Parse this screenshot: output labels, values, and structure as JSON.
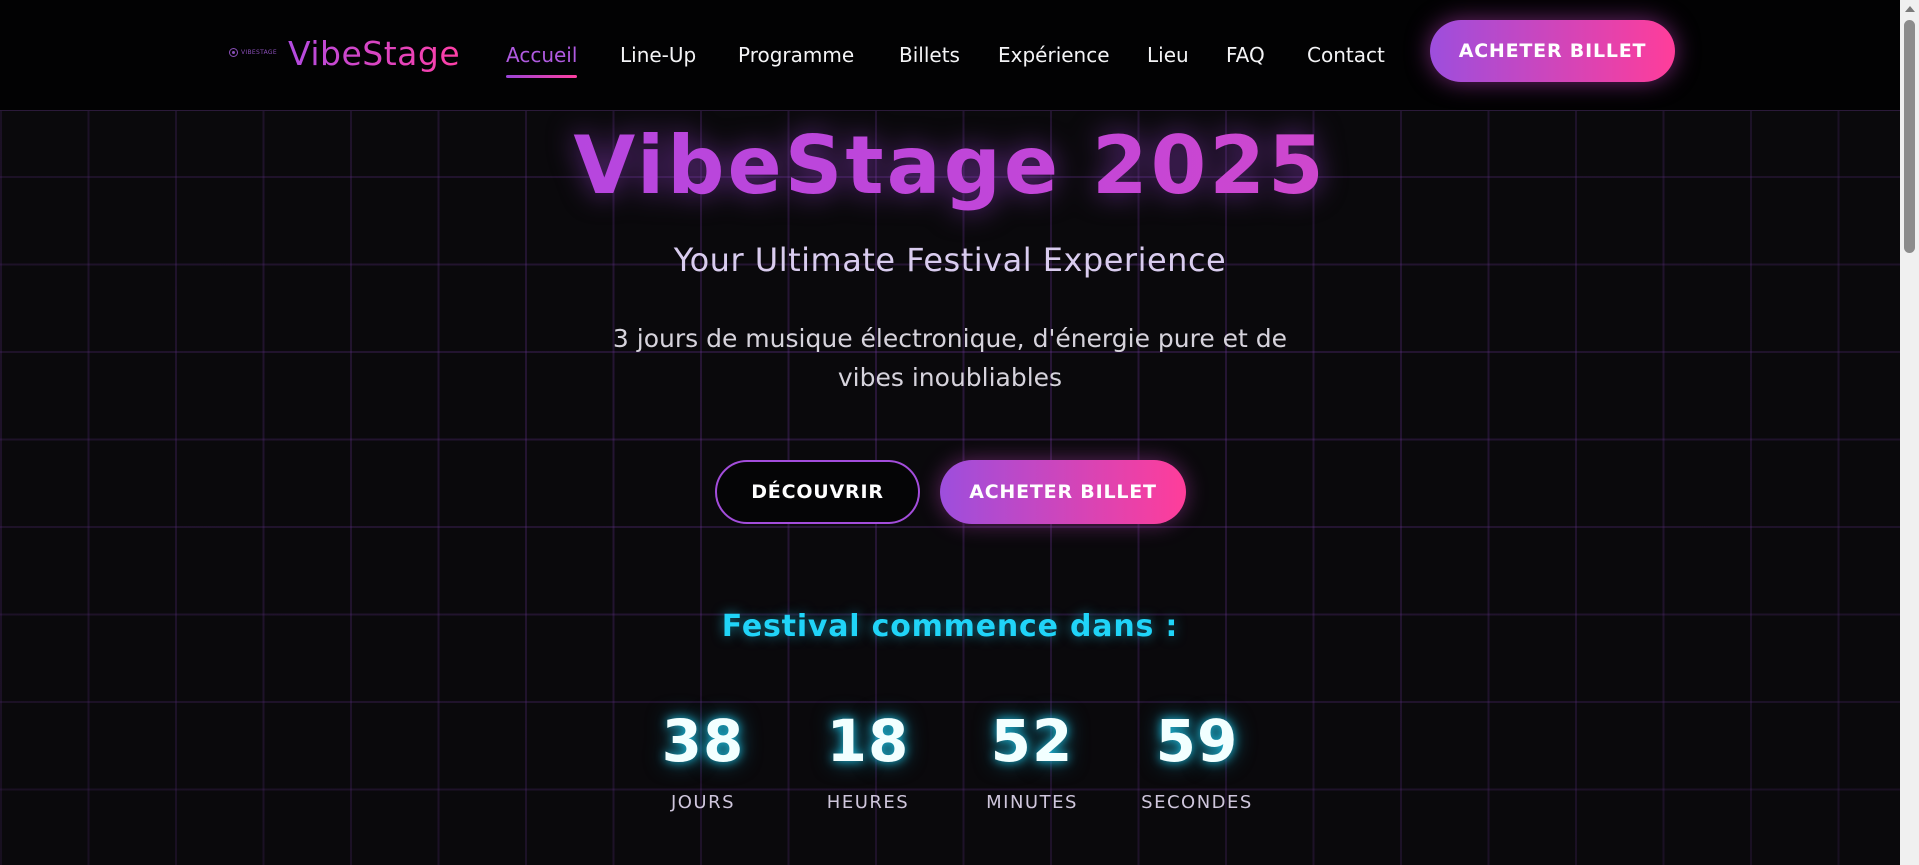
{
  "nav": {
    "mini_logo_text": "VIBESTAGE",
    "brand": "VibeStage",
    "links": [
      {
        "label": "Accueil"
      },
      {
        "label": "Line-Up"
      },
      {
        "label": "Programme"
      },
      {
        "label": "Billets"
      },
      {
        "label": "Expérience"
      },
      {
        "label": "Lieu"
      },
      {
        "label": "FAQ"
      },
      {
        "label": "Contact"
      }
    ],
    "active_link": "Accueil",
    "cta_label": "ACHETER BILLET"
  },
  "hero": {
    "title": "VibeStage 2025",
    "subtitle": "Your Ultimate Festival Experience",
    "description": "3 jours de musique électronique, d'énergie pure et de vibes inoubliables",
    "discover_label": "DÉCOUVRIR",
    "buy_label": "ACHETER BILLET"
  },
  "countdown": {
    "title": "Festival commence dans :",
    "units": [
      {
        "value": "38",
        "label": "JOURS"
      },
      {
        "value": "18",
        "label": "HEURES"
      },
      {
        "value": "52",
        "label": "MINUTES"
      },
      {
        "value": "59",
        "label": "SECONDES"
      }
    ]
  },
  "colors": {
    "accent_purple": "#9d4edd",
    "accent_pink": "#ff3d9a",
    "countdown_cyan": "#20d4f8",
    "background": "#070709"
  },
  "icons": {
    "mini_logo": "vibestage-logo-icon",
    "scroll_up": "scroll-up-arrow-icon"
  }
}
